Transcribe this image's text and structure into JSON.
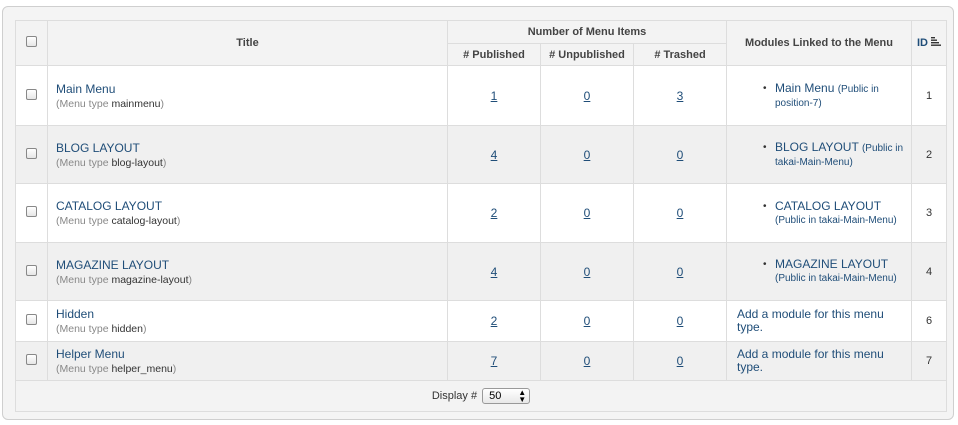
{
  "header": {
    "title": "Title",
    "group": "Number of Menu Items",
    "published": "# Published",
    "unpublished": "# Unpublished",
    "trashed": "# Trashed",
    "modules": "Modules Linked to the Menu",
    "id": "ID"
  },
  "menutype_prefix": "Menu type",
  "rows": [
    {
      "title": "Main Menu",
      "menutype": "mainmenu",
      "published": "1",
      "unpublished": "0",
      "trashed": "3",
      "module_name": "Main Menu",
      "module_info": "(Public in position-7)",
      "id": "1"
    },
    {
      "title": "BLOG LAYOUT",
      "menutype": "blog-layout",
      "published": "4",
      "unpublished": "0",
      "trashed": "0",
      "module_name": "BLOG LAYOUT",
      "module_info": "(Public in takai-Main-Menu)",
      "id": "2"
    },
    {
      "title": "CATALOG LAYOUT",
      "menutype": "catalog-layout",
      "published": "2",
      "unpublished": "0",
      "trashed": "0",
      "module_name": "CATALOG LAYOUT",
      "module_info": "(Public in takai-Main-Menu)",
      "id": "3"
    },
    {
      "title": "MAGAZINE LAYOUT",
      "menutype": "magazine-layout",
      "published": "4",
      "unpublished": "0",
      "trashed": "0",
      "module_name": "MAGAZINE LAYOUT",
      "module_info": "(Public in takai-Main-Menu)",
      "id": "4"
    },
    {
      "title": "Hidden",
      "menutype": "hidden",
      "published": "2",
      "unpublished": "0",
      "trashed": "0",
      "add_module": "Add a module for this menu type.",
      "id": "6"
    },
    {
      "title": "Helper Menu",
      "menutype": "helper_menu",
      "published": "7",
      "unpublished": "0",
      "trashed": "0",
      "add_module": "Add a module for this menu type.",
      "id": "7"
    }
  ],
  "footer": {
    "display_label": "Display #",
    "display_value": "50"
  },
  "icons": {
    "checkbox": "checkbox-icon",
    "sort": "sort-ascending-icon",
    "select_arrow": "up-down-arrows-icon"
  }
}
